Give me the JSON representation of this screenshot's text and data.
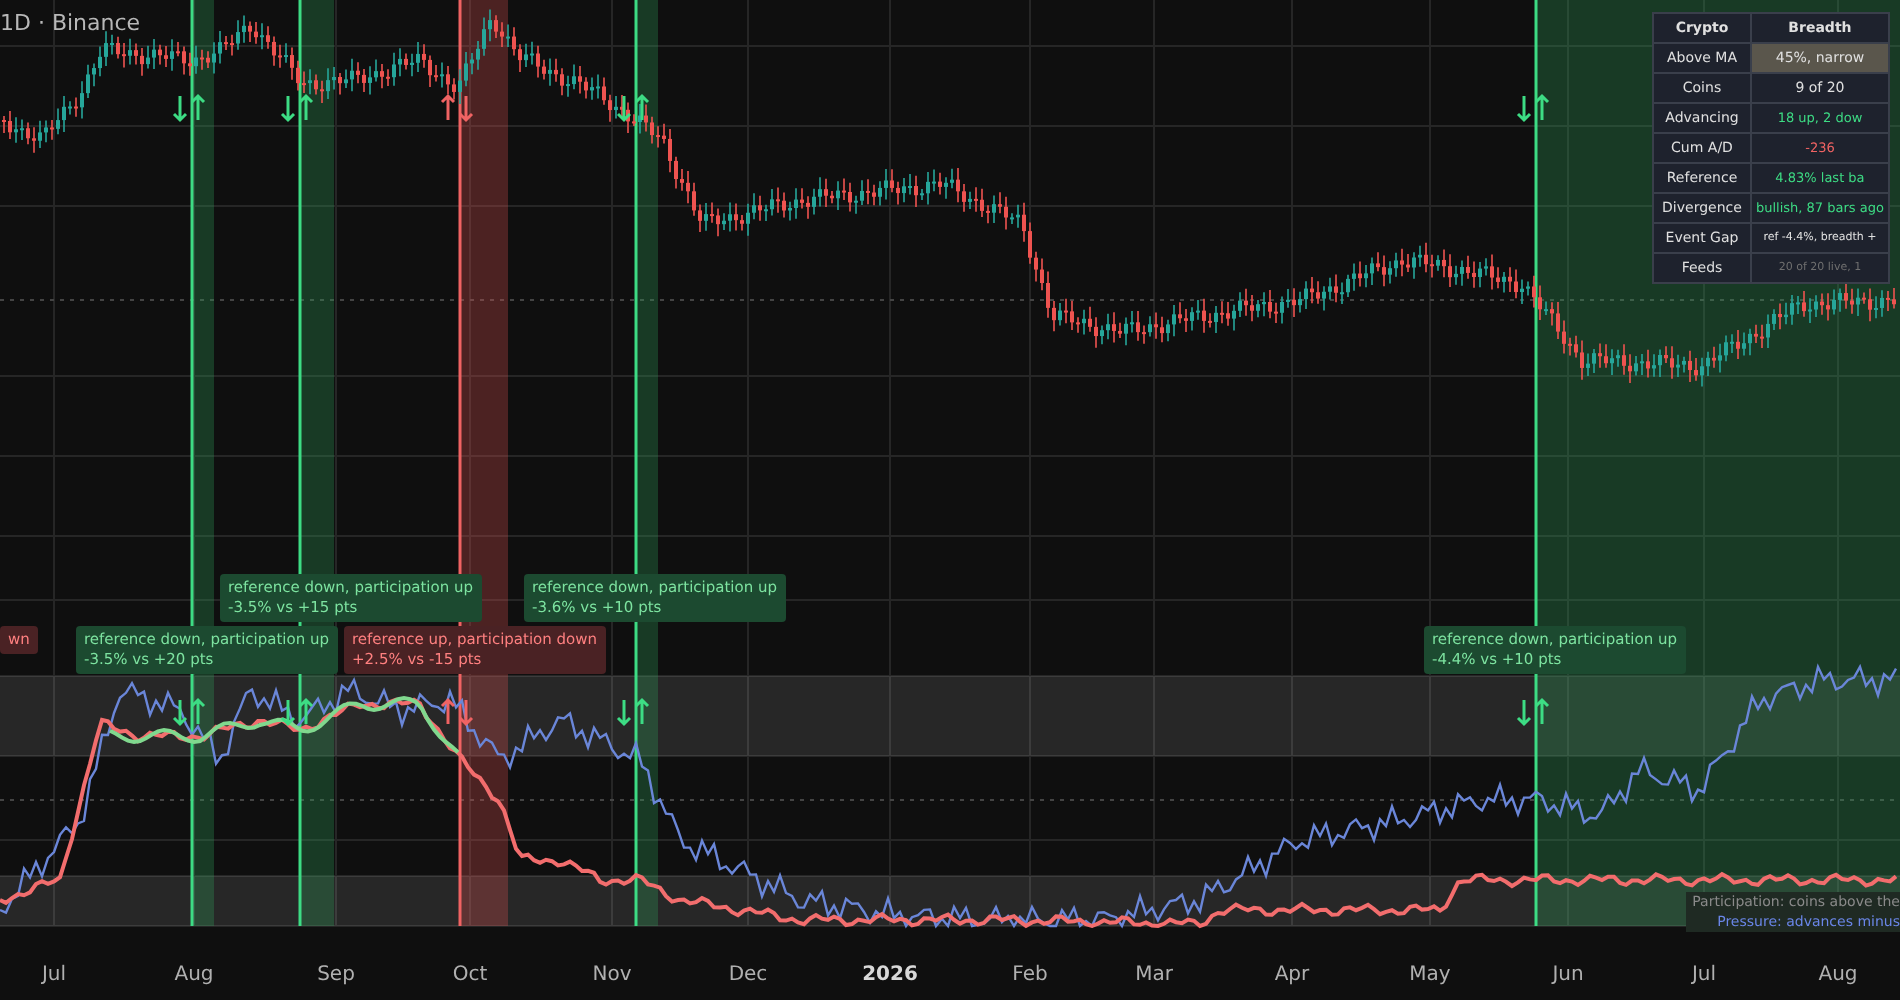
{
  "chart": {
    "symbol": "1D · Binance"
  },
  "breadth_table": {
    "columns": [
      "Crypto",
      "Breadth"
    ],
    "rows": [
      {
        "label": "Above MA",
        "value": "45%, narrow",
        "kind": "neutral",
        "highlight": true
      },
      {
        "label": "Coins",
        "value": "9 of 20",
        "kind": "neutral",
        "highlight": false
      },
      {
        "label": "Advancing",
        "value": "18 up, 2 dow",
        "kind": "positive",
        "highlight": false
      },
      {
        "label": "Cum A/D",
        "value": "-236",
        "kind": "negative",
        "highlight": false
      },
      {
        "label": "Reference",
        "value": "4.83% last ba",
        "kind": "positive",
        "highlight": false
      },
      {
        "label": "Divergence",
        "value": "bullish, 87 bars ago",
        "kind": "positive",
        "highlight": false
      },
      {
        "label": "Event Gap",
        "value": "ref -4.4%, breadth +",
        "kind": "small",
        "highlight": false
      },
      {
        "label": "Feeds",
        "value": "20 of 20 live, 1",
        "kind": "muted",
        "highlight": false
      }
    ]
  },
  "signals": [
    {
      "kind": "bullish"
    },
    {
      "kind": "bullish"
    },
    {
      "kind": "bearish"
    },
    {
      "kind": "bullish"
    },
    {
      "kind": "bullish"
    }
  ],
  "callouts": [
    {
      "kind": "bearish",
      "title": "wn"
    },
    {
      "kind": "bullish",
      "title": "reference down, participation up",
      "detail": "-3.5% vs +20 pts"
    },
    {
      "kind": "bullish",
      "title": "reference down, participation up",
      "detail": "-3.5% vs +15 pts"
    },
    {
      "kind": "bearish",
      "title": "reference up, participation down",
      "detail": "+2.5% vs -15 pts"
    },
    {
      "kind": "bullish",
      "title": "reference down, participation up",
      "detail": "-3.6% vs +10 pts"
    },
    {
      "kind": "bullish",
      "title": "reference down, participation up",
      "detail": "-4.4% vs +10 pts"
    }
  ],
  "legend": [
    {
      "kind": "participation",
      "text": "Participation: coins above the"
    },
    {
      "kind": "pressure",
      "text": "Pressure: advances minus"
    }
  ],
  "x_axis": [
    {
      "label": "Jul",
      "bold": false
    },
    {
      "label": "Aug",
      "bold": false
    },
    {
      "label": "Sep",
      "bold": false
    },
    {
      "label": "Oct",
      "bold": false
    },
    {
      "label": "Nov",
      "bold": false
    },
    {
      "label": "Dec",
      "bold": false
    },
    {
      "label": "2026",
      "bold": true
    },
    {
      "label": "Feb",
      "bold": false
    },
    {
      "label": "Mar",
      "bold": false
    },
    {
      "label": "Apr",
      "bold": false
    },
    {
      "label": "May",
      "bold": false
    },
    {
      "label": "Jun",
      "bold": false
    },
    {
      "label": "Jul",
      "bold": false
    },
    {
      "label": "Aug",
      "bold": false
    }
  ]
}
